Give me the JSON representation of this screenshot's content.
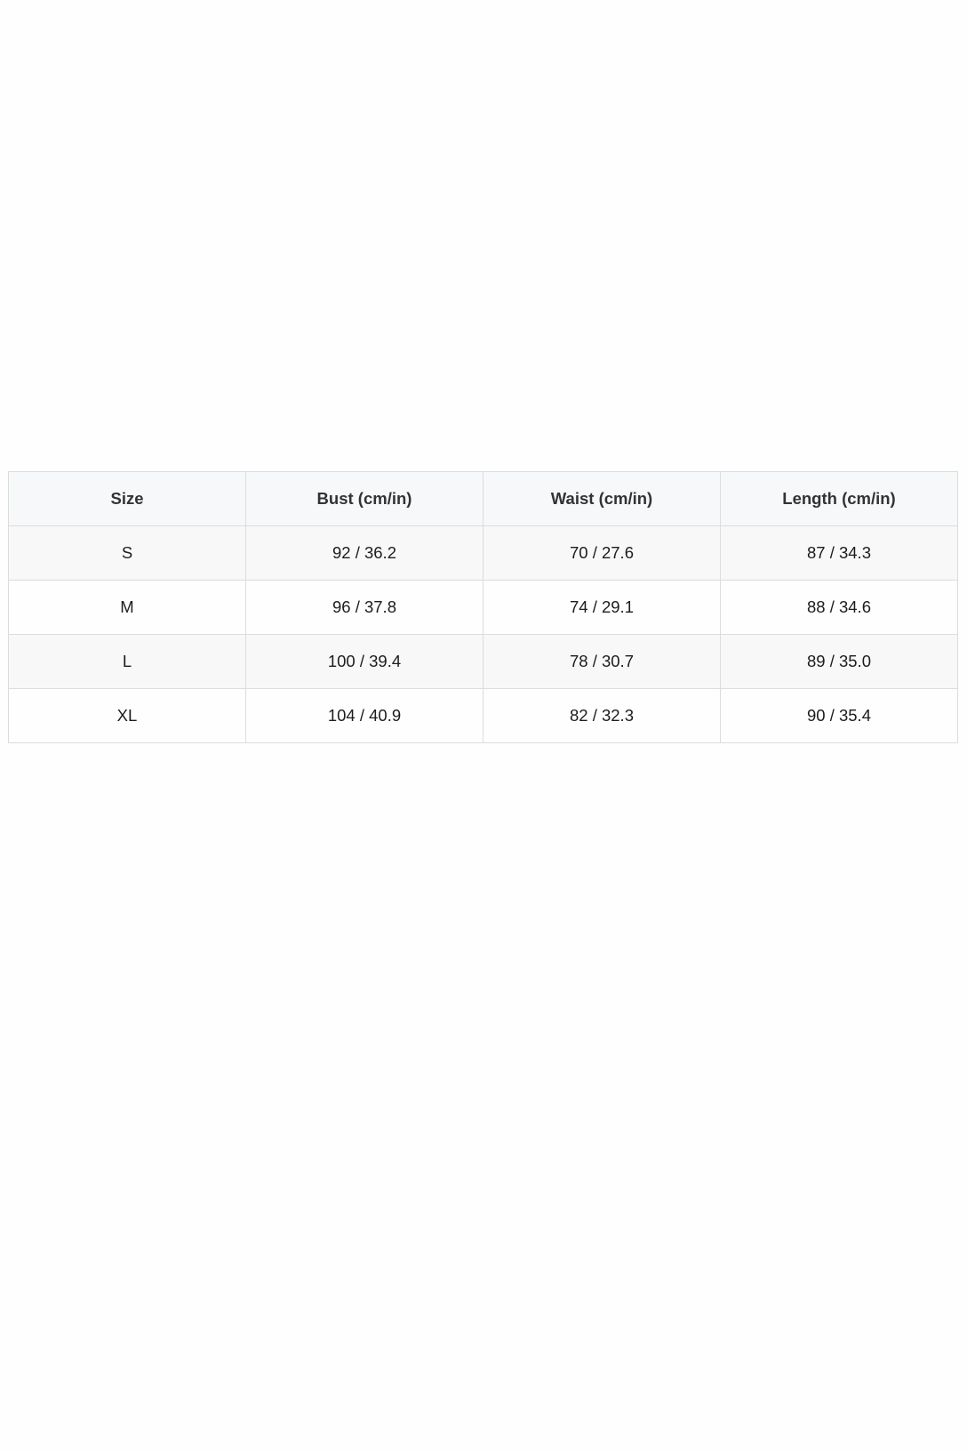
{
  "size_chart": {
    "headers": [
      "Size",
      "Bust (cm/in)",
      "Waist (cm/in)",
      "Length (cm/in)"
    ],
    "rows": [
      [
        "S",
        "92 / 36.2",
        "70 / 27.6",
        "87 / 34.3"
      ],
      [
        "M",
        "96 / 37.8",
        "74 / 29.1",
        "88 / 34.6"
      ],
      [
        "L",
        "100 / 39.4",
        "78 / 30.7",
        "89 / 35.0"
      ],
      [
        "XL",
        "104 / 40.9",
        "82 / 32.3",
        "90 / 35.4"
      ]
    ]
  },
  "colors": {
    "border": "#dcdcdc",
    "header_background": "#f7f8f9",
    "striped_row_background": "#f8f8f8",
    "page_background": "#fefefe",
    "text": "#1c1c1c"
  }
}
